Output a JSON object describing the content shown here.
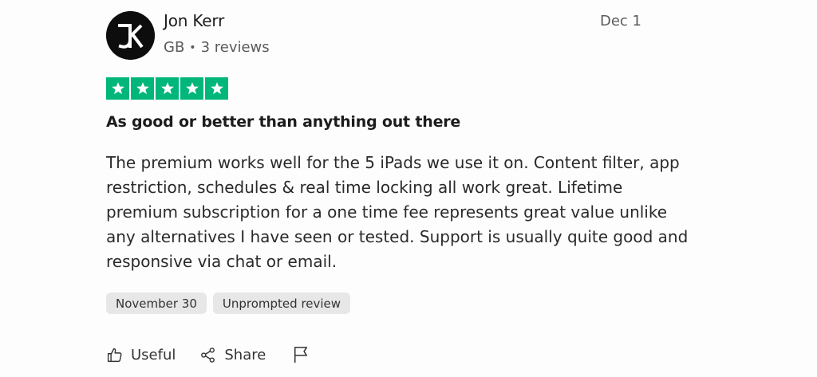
{
  "reviewer": {
    "name": "Jon Kerr",
    "country": "GB",
    "separator": "•",
    "review_count": "3 reviews",
    "avatar_icon": "jk-monogram-icon"
  },
  "review": {
    "date": "Dec 1",
    "rating": 5,
    "rating_max": 5,
    "star_color": "#00b67a",
    "title": "As good or better than anything out there",
    "body_lines": [
      "The premium works well for the 5 iPads we use it on. Content filter, app",
      "restriction, schedules & real time locking all work great. Lifetime",
      "premium subscription for a one time fee represents great value unlike",
      "any alternatives I have seen or tested. Support is usually quite good and",
      "responsive via chat or email."
    ],
    "tags": [
      "November 30",
      "Unprompted review"
    ]
  },
  "actions": {
    "useful_label": "Useful",
    "share_label": "Share",
    "useful_icon": "thumbs-up-icon",
    "share_icon": "share-icon",
    "report_icon": "flag-icon"
  }
}
